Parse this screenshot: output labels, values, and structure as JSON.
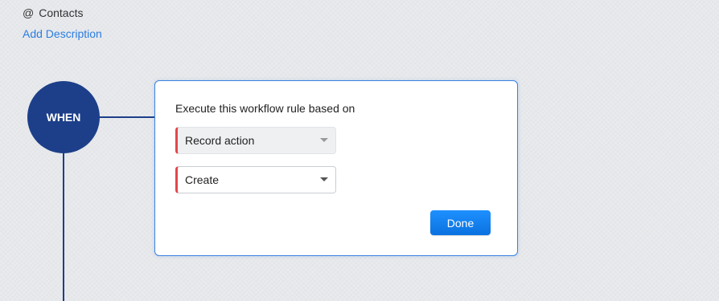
{
  "module": {
    "at_symbol": "@",
    "name": "Contacts"
  },
  "add_description_label": "Add Description",
  "when_node": {
    "label": "WHEN"
  },
  "rule_panel": {
    "heading": "Execute this workflow rule based on",
    "record_action": {
      "value": "Record action",
      "icon": "caret-down-icon"
    },
    "trigger": {
      "value": "Create",
      "icon": "caret-down-icon"
    },
    "done_label": "Done"
  },
  "colors": {
    "node_blue": "#1d3f8a",
    "link_blue": "#2a7de1",
    "button_blue": "#1e90ff",
    "required_marker": "#e2474b"
  }
}
